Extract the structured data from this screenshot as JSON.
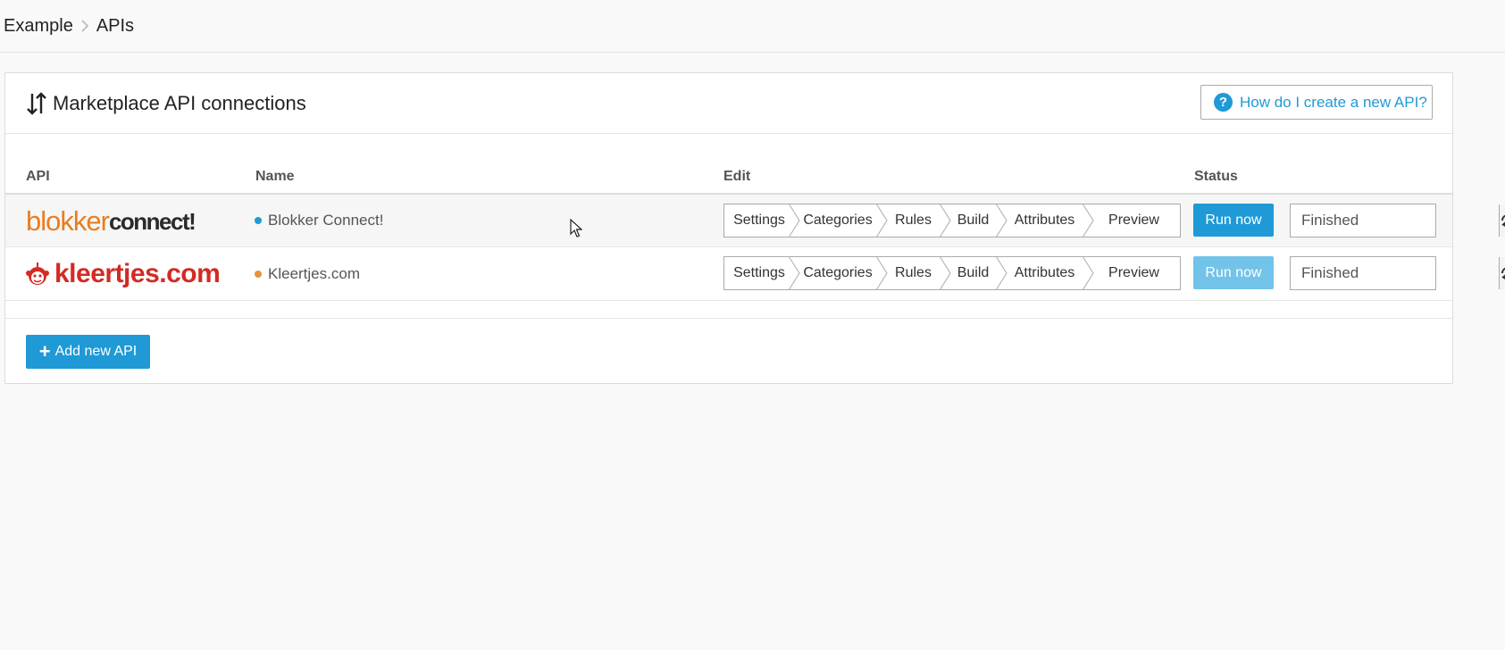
{
  "breadcrumb": {
    "items": [
      "Example",
      "APIs"
    ]
  },
  "panel": {
    "title": "Marketplace API connections",
    "title_icon": "sort-arrows-icon",
    "help_button": "How do I create a new API?"
  },
  "table": {
    "headers": {
      "api": "API",
      "name": "Name",
      "edit": "Edit",
      "status": "Status"
    },
    "rows": [
      {
        "logo_part1": "blokker",
        "logo_part2": "connect!",
        "name": "Blokker Connect!",
        "dot_color": "#1f9ad6",
        "steps": [
          "Settings",
          "Categories",
          "Rules",
          "Build",
          "Attributes",
          "Preview"
        ],
        "run_label": "Run now",
        "run_color": "#1f9ad6",
        "status": "Finished"
      },
      {
        "logo_text": "kleertjes.com",
        "name": "Kleertjes.com",
        "dot_color": "#e8913a",
        "steps": [
          "Settings",
          "Categories",
          "Rules",
          "Build",
          "Attributes",
          "Preview"
        ],
        "run_label": "Run now",
        "run_color": "#72c3ea",
        "status": "Finished"
      }
    ]
  },
  "footer": {
    "add_button": "Add new API"
  },
  "colors": {
    "accent": "#1f9ad6",
    "disabled_accent": "#72c3ea",
    "blokker_orange": "#ea7d1f",
    "kleertjes_red": "#d42a24"
  }
}
